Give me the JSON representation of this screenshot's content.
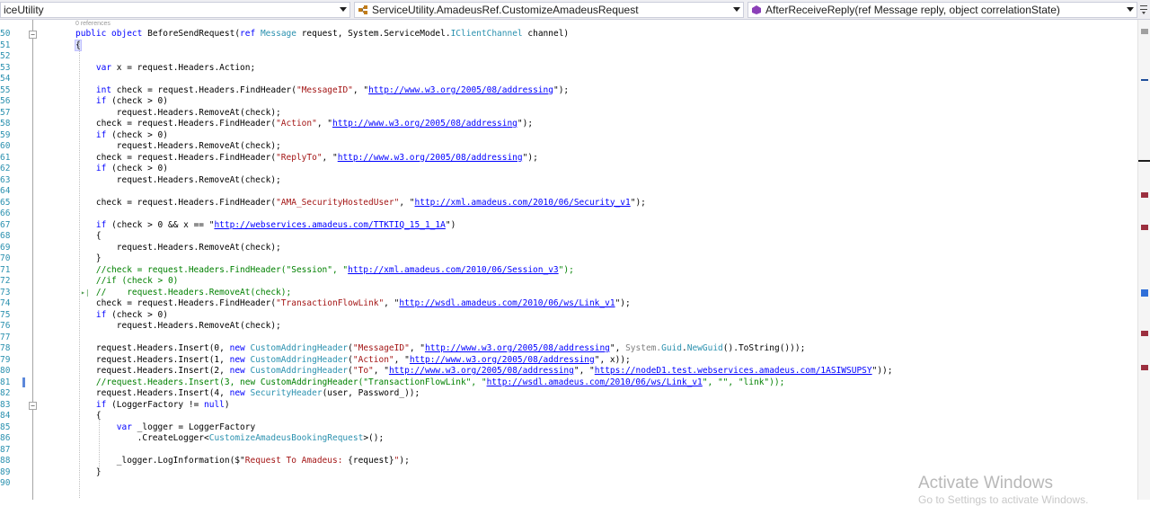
{
  "navbar": {
    "project": "iceUtility",
    "class_member": "ServiceUtility.AmadeusRef.CustomizeAmadeusRequest",
    "method": "AfterReceiveReply(ref Message reply, object correlationState)"
  },
  "editor": {
    "codelens": "0 references",
    "line_numbers": [
      "50",
      "51",
      "52",
      "53",
      "54",
      "55",
      "56",
      "57",
      "58",
      "59",
      "60",
      "61",
      "62",
      "63",
      "64",
      "65",
      "66",
      "67",
      "68",
      "69",
      "70",
      "71",
      "72",
      "73",
      "74",
      "75",
      "76",
      "77",
      "78",
      "79",
      "80",
      "81",
      "82",
      "83",
      "84",
      "85",
      "86",
      "87",
      "88",
      "89",
      "90"
    ]
  },
  "colors": {
    "keyword": "#0000ff",
    "type": "#2b91af",
    "string": "#a31515",
    "comment": "#008000"
  },
  "watermark": {
    "title": "Activate Windows",
    "subtitle": "Go to Settings to activate Windows."
  }
}
